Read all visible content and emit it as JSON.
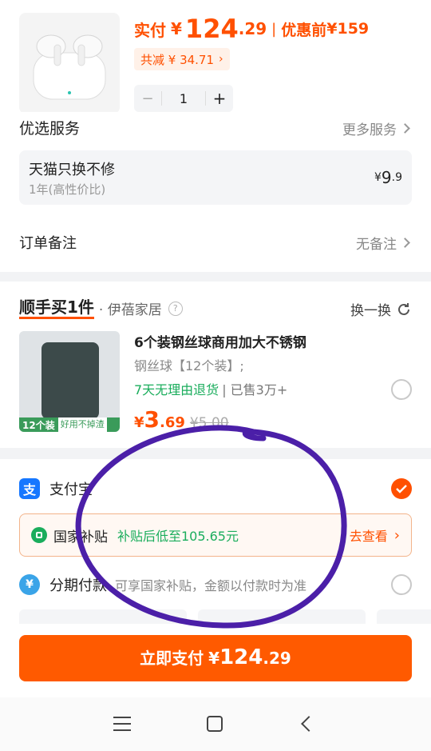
{
  "product": {
    "paid_label": "实付",
    "currency": "¥",
    "price_int": "124",
    "price_dec": ".29",
    "sep": "|",
    "before_label": "优惠前",
    "before_price": "¥159",
    "discount_label": "共减 ¥ 34.71",
    "quantity": "1",
    "minus": "−",
    "plus": "+"
  },
  "services": {
    "title": "优选服务",
    "more": "更多服务",
    "item_name": "天猫只换不修",
    "item_sub": "1年(高性价比)",
    "item_price_sym": "¥",
    "item_price_int": "9",
    "item_price_dec": ".9"
  },
  "note": {
    "label": "订单备注",
    "value": "无备注"
  },
  "addon": {
    "brand": "顺手买1件",
    "shop": "· 伊蓓家居",
    "swap": "换一换",
    "title": "6个装钢丝球商用加大不锈钢",
    "subtitle": "钢丝球【12个装】;",
    "return_policy": "7天无理由退货",
    "sold": "| 已售3万+",
    "price_sym": "¥",
    "price_int": "3",
    "price_dec": ".69",
    "orig_price": "¥5.00",
    "img_badge": "12个装",
    "img_badge2": "好用不掉渣"
  },
  "payment": {
    "alipay_label": "支付宝",
    "subsidy_label": "国家补贴",
    "subsidy_text": "补贴后低至105.65元",
    "subsidy_link": "去查看",
    "installment_label": "分期付款",
    "installment_text": "可享国家补贴，金额以付款时为准"
  },
  "pay_button": {
    "label": "立即支付",
    "sym": "¥",
    "int": "124",
    "dec": ".29"
  },
  "colors": {
    "accent": "#ff5000",
    "green": "#1aad5c",
    "annotation": "#4b1fa8"
  }
}
